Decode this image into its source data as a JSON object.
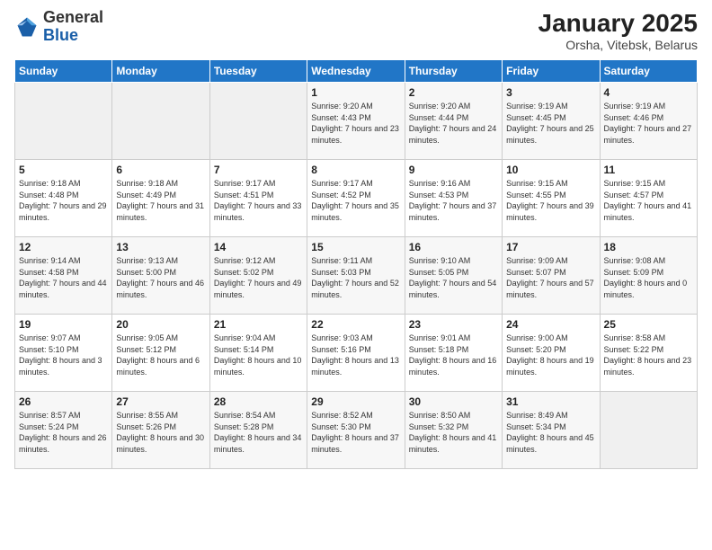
{
  "header": {
    "logo_general": "General",
    "logo_blue": "Blue",
    "title": "January 2025",
    "subtitle": "Orsha, Vitebsk, Belarus"
  },
  "days_of_week": [
    "Sunday",
    "Monday",
    "Tuesday",
    "Wednesday",
    "Thursday",
    "Friday",
    "Saturday"
  ],
  "weeks": [
    [
      {
        "num": "",
        "info": ""
      },
      {
        "num": "",
        "info": ""
      },
      {
        "num": "",
        "info": ""
      },
      {
        "num": "1",
        "info": "Sunrise: 9:20 AM\nSunset: 4:43 PM\nDaylight: 7 hours and 23 minutes."
      },
      {
        "num": "2",
        "info": "Sunrise: 9:20 AM\nSunset: 4:44 PM\nDaylight: 7 hours and 24 minutes."
      },
      {
        "num": "3",
        "info": "Sunrise: 9:19 AM\nSunset: 4:45 PM\nDaylight: 7 hours and 25 minutes."
      },
      {
        "num": "4",
        "info": "Sunrise: 9:19 AM\nSunset: 4:46 PM\nDaylight: 7 hours and 27 minutes."
      }
    ],
    [
      {
        "num": "5",
        "info": "Sunrise: 9:18 AM\nSunset: 4:48 PM\nDaylight: 7 hours and 29 minutes."
      },
      {
        "num": "6",
        "info": "Sunrise: 9:18 AM\nSunset: 4:49 PM\nDaylight: 7 hours and 31 minutes."
      },
      {
        "num": "7",
        "info": "Sunrise: 9:17 AM\nSunset: 4:51 PM\nDaylight: 7 hours and 33 minutes."
      },
      {
        "num": "8",
        "info": "Sunrise: 9:17 AM\nSunset: 4:52 PM\nDaylight: 7 hours and 35 minutes."
      },
      {
        "num": "9",
        "info": "Sunrise: 9:16 AM\nSunset: 4:53 PM\nDaylight: 7 hours and 37 minutes."
      },
      {
        "num": "10",
        "info": "Sunrise: 9:15 AM\nSunset: 4:55 PM\nDaylight: 7 hours and 39 minutes."
      },
      {
        "num": "11",
        "info": "Sunrise: 9:15 AM\nSunset: 4:57 PM\nDaylight: 7 hours and 41 minutes."
      }
    ],
    [
      {
        "num": "12",
        "info": "Sunrise: 9:14 AM\nSunset: 4:58 PM\nDaylight: 7 hours and 44 minutes."
      },
      {
        "num": "13",
        "info": "Sunrise: 9:13 AM\nSunset: 5:00 PM\nDaylight: 7 hours and 46 minutes."
      },
      {
        "num": "14",
        "info": "Sunrise: 9:12 AM\nSunset: 5:02 PM\nDaylight: 7 hours and 49 minutes."
      },
      {
        "num": "15",
        "info": "Sunrise: 9:11 AM\nSunset: 5:03 PM\nDaylight: 7 hours and 52 minutes."
      },
      {
        "num": "16",
        "info": "Sunrise: 9:10 AM\nSunset: 5:05 PM\nDaylight: 7 hours and 54 minutes."
      },
      {
        "num": "17",
        "info": "Sunrise: 9:09 AM\nSunset: 5:07 PM\nDaylight: 7 hours and 57 minutes."
      },
      {
        "num": "18",
        "info": "Sunrise: 9:08 AM\nSunset: 5:09 PM\nDaylight: 8 hours and 0 minutes."
      }
    ],
    [
      {
        "num": "19",
        "info": "Sunrise: 9:07 AM\nSunset: 5:10 PM\nDaylight: 8 hours and 3 minutes."
      },
      {
        "num": "20",
        "info": "Sunrise: 9:05 AM\nSunset: 5:12 PM\nDaylight: 8 hours and 6 minutes."
      },
      {
        "num": "21",
        "info": "Sunrise: 9:04 AM\nSunset: 5:14 PM\nDaylight: 8 hours and 10 minutes."
      },
      {
        "num": "22",
        "info": "Sunrise: 9:03 AM\nSunset: 5:16 PM\nDaylight: 8 hours and 13 minutes."
      },
      {
        "num": "23",
        "info": "Sunrise: 9:01 AM\nSunset: 5:18 PM\nDaylight: 8 hours and 16 minutes."
      },
      {
        "num": "24",
        "info": "Sunrise: 9:00 AM\nSunset: 5:20 PM\nDaylight: 8 hours and 19 minutes."
      },
      {
        "num": "25",
        "info": "Sunrise: 8:58 AM\nSunset: 5:22 PM\nDaylight: 8 hours and 23 minutes."
      }
    ],
    [
      {
        "num": "26",
        "info": "Sunrise: 8:57 AM\nSunset: 5:24 PM\nDaylight: 8 hours and 26 minutes."
      },
      {
        "num": "27",
        "info": "Sunrise: 8:55 AM\nSunset: 5:26 PM\nDaylight: 8 hours and 30 minutes."
      },
      {
        "num": "28",
        "info": "Sunrise: 8:54 AM\nSunset: 5:28 PM\nDaylight: 8 hours and 34 minutes."
      },
      {
        "num": "29",
        "info": "Sunrise: 8:52 AM\nSunset: 5:30 PM\nDaylight: 8 hours and 37 minutes."
      },
      {
        "num": "30",
        "info": "Sunrise: 8:50 AM\nSunset: 5:32 PM\nDaylight: 8 hours and 41 minutes."
      },
      {
        "num": "31",
        "info": "Sunrise: 8:49 AM\nSunset: 5:34 PM\nDaylight: 8 hours and 45 minutes."
      },
      {
        "num": "",
        "info": ""
      }
    ]
  ]
}
